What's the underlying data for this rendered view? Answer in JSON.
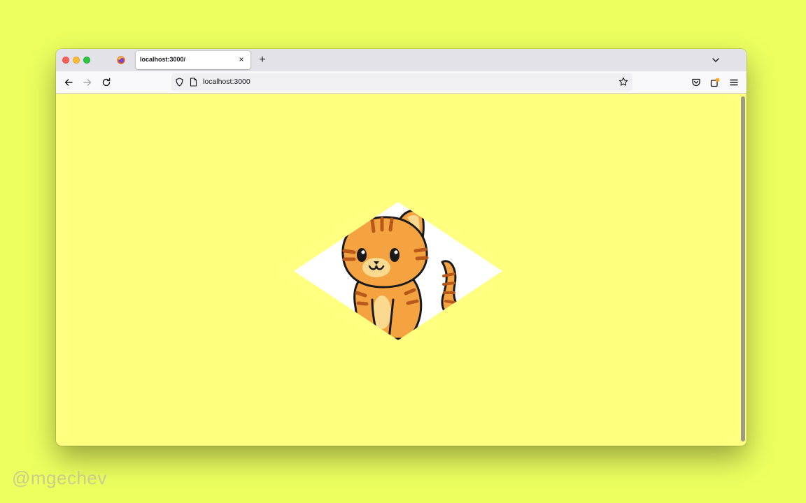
{
  "browser": {
    "tab": {
      "title": "localhost:3000/",
      "close_glyph": "×"
    },
    "new_tab_glyph": "+",
    "address_bar": {
      "url": "localhost:3000"
    },
    "icons": {
      "tab_favicon": "firefox-icon",
      "back": "arrow-left-icon",
      "forward": "arrow-right-icon",
      "reload": "reload-icon",
      "tracking_protection": "shield-icon",
      "page_info": "page-icon",
      "bookmark": "star-icon",
      "pocket": "pocket-icon",
      "extensions": "extensions-icon",
      "menu": "hamburger-menu-icon",
      "tab_list": "chevron-down-icon"
    }
  },
  "page": {
    "background_color": "#ffff80",
    "illustration": "cat-in-diamond"
  },
  "watermark": "@mgechev",
  "colors": {
    "desktop": "#ecff5f",
    "page": "#ffff80",
    "cat_orange": "#f5a340",
    "cat_stripes": "#b8591a",
    "diamond": "#ffffff"
  }
}
